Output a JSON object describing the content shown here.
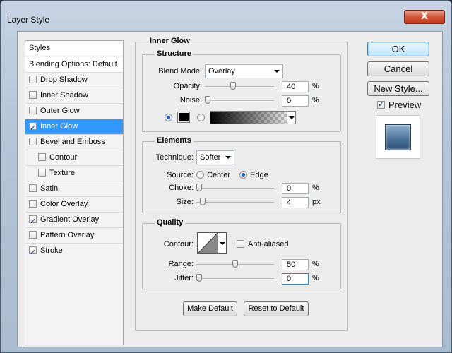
{
  "window": {
    "title": "Layer Style",
    "close_glyph": "X"
  },
  "styles_list": [
    {
      "label": "Styles",
      "type": "header"
    },
    {
      "label": "Blending Options: Default",
      "type": "header"
    },
    {
      "label": "Drop Shadow",
      "checked": false
    },
    {
      "label": "Inner Shadow",
      "checked": false
    },
    {
      "label": "Outer Glow",
      "checked": false
    },
    {
      "label": "Inner Glow",
      "checked": true,
      "selected": true
    },
    {
      "label": "Bevel and Emboss",
      "checked": false
    },
    {
      "label": "Contour",
      "checked": false,
      "indent": true
    },
    {
      "label": "Texture",
      "checked": false,
      "indent": true
    },
    {
      "label": "Satin",
      "checked": false
    },
    {
      "label": "Color Overlay",
      "checked": false
    },
    {
      "label": "Gradient Overlay",
      "checked": true
    },
    {
      "label": "Pattern Overlay",
      "checked": false
    },
    {
      "label": "Stroke",
      "checked": true
    }
  ],
  "panel": {
    "title": "Inner Glow"
  },
  "structure": {
    "title": "Structure",
    "blend_mode_label": "Blend Mode:",
    "blend_mode": "Overlay",
    "opacity_label": "Opacity:",
    "opacity": "40",
    "opacity_level": 0.4,
    "noise_label": "Noise:",
    "noise": "0",
    "noise_level": 0,
    "percent": "%",
    "color_swatch": "#000000"
  },
  "elements": {
    "title": "Elements",
    "technique_label": "Technique:",
    "technique": "Softer",
    "source_label": "Source:",
    "source_center": "Center",
    "source_edge": "Edge",
    "choke_label": "Choke:",
    "choke": "0",
    "choke_level": 0,
    "size_label": "Size:",
    "size": "4",
    "size_unit": "px",
    "percent": "%"
  },
  "quality": {
    "title": "Quality",
    "contour_label": "Contour:",
    "anti_aliased_label": "Anti-aliased",
    "range_label": "Range:",
    "range": "50",
    "range_level": 0.5,
    "jitter_label": "Jitter:",
    "jitter": "0",
    "jitter_level": 0,
    "percent": "%"
  },
  "buttons": {
    "make_default": "Make Default",
    "reset_to_default": "Reset to Default",
    "ok": "OK",
    "cancel": "Cancel",
    "new_style": "New Style...",
    "preview_label": "Preview"
  },
  "colors": {
    "selection": "#3399ff",
    "window_chrome": "#b4c5d8",
    "preview_fill": "#4a6f96"
  }
}
